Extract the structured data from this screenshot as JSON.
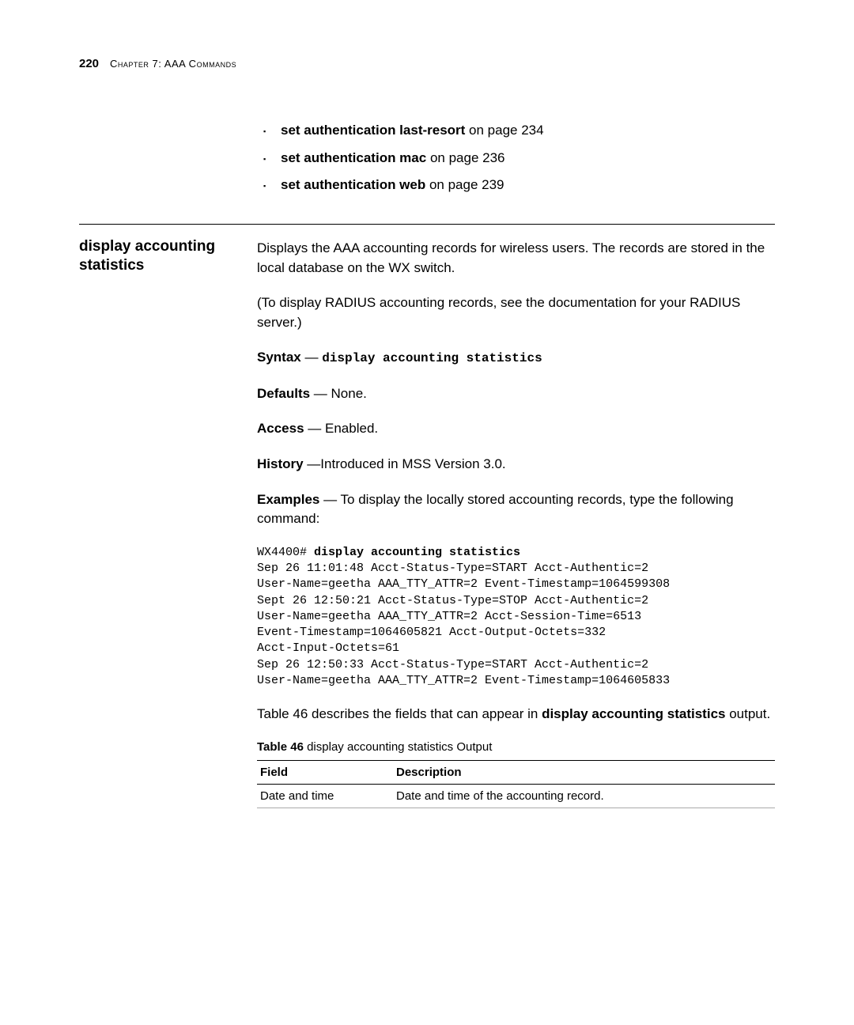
{
  "header": {
    "page_number": "220",
    "chapter": "Chapter 7: AAA Commands"
  },
  "top_bullets": [
    {
      "cmd": "set authentication last-resort",
      "suffix": " on page 234"
    },
    {
      "cmd": "set authentication mac",
      "suffix": " on page 236"
    },
    {
      "cmd": "set authentication web",
      "suffix": " on page 239"
    }
  ],
  "section": {
    "sidebar_title": "display accounting statistics",
    "intro": "Displays the AAA accounting records for wireless users. The records are stored in the local database on the WX switch.",
    "note": "(To display RADIUS accounting records, see the documentation for your RADIUS server.)",
    "syntax_label": "Syntax",
    "syntax_cmd": "display accounting statistics",
    "defaults_label": "Defaults",
    "defaults_value": " — None.",
    "access_label": "Access",
    "access_value": " — Enabled.",
    "history_label": "History",
    "history_value": " —Introduced in MSS Version 3.0.",
    "examples_label": "Examples",
    "examples_value": " — To display the locally stored accounting records, type the following command:",
    "example_prompt": "WX4400# ",
    "example_cmd": "display accounting statistics",
    "example_output": "Sep 26 11:01:48 Acct-Status-Type=START Acct-Authentic=2\nUser-Name=geetha AAA_TTY_ATTR=2 Event-Timestamp=1064599308\nSept 26 12:50:21 Acct-Status-Type=STOP Acct-Authentic=2\nUser-Name=geetha AAA_TTY_ATTR=2 Acct-Session-Time=6513\nEvent-Timestamp=1064605821 Acct-Output-Octets=332\nAcct-Input-Octets=61\nSep 26 12:50:33 Acct-Status-Type=START Acct-Authentic=2\nUser-Name=geetha AAA_TTY_ATTR=2 Event-Timestamp=1064605833",
    "table_intro_pre": "Table 46 describes the fields that can appear in ",
    "table_intro_cmd": "display accounting statistics",
    "table_intro_post": " output.",
    "table_caption_label": "Table 46",
    "table_caption_text": "   display accounting statistics Output",
    "table": {
      "headers": {
        "field": "Field",
        "description": "Description"
      },
      "rows": [
        {
          "field": "Date and time",
          "description": "Date and time of the accounting record."
        }
      ]
    }
  }
}
